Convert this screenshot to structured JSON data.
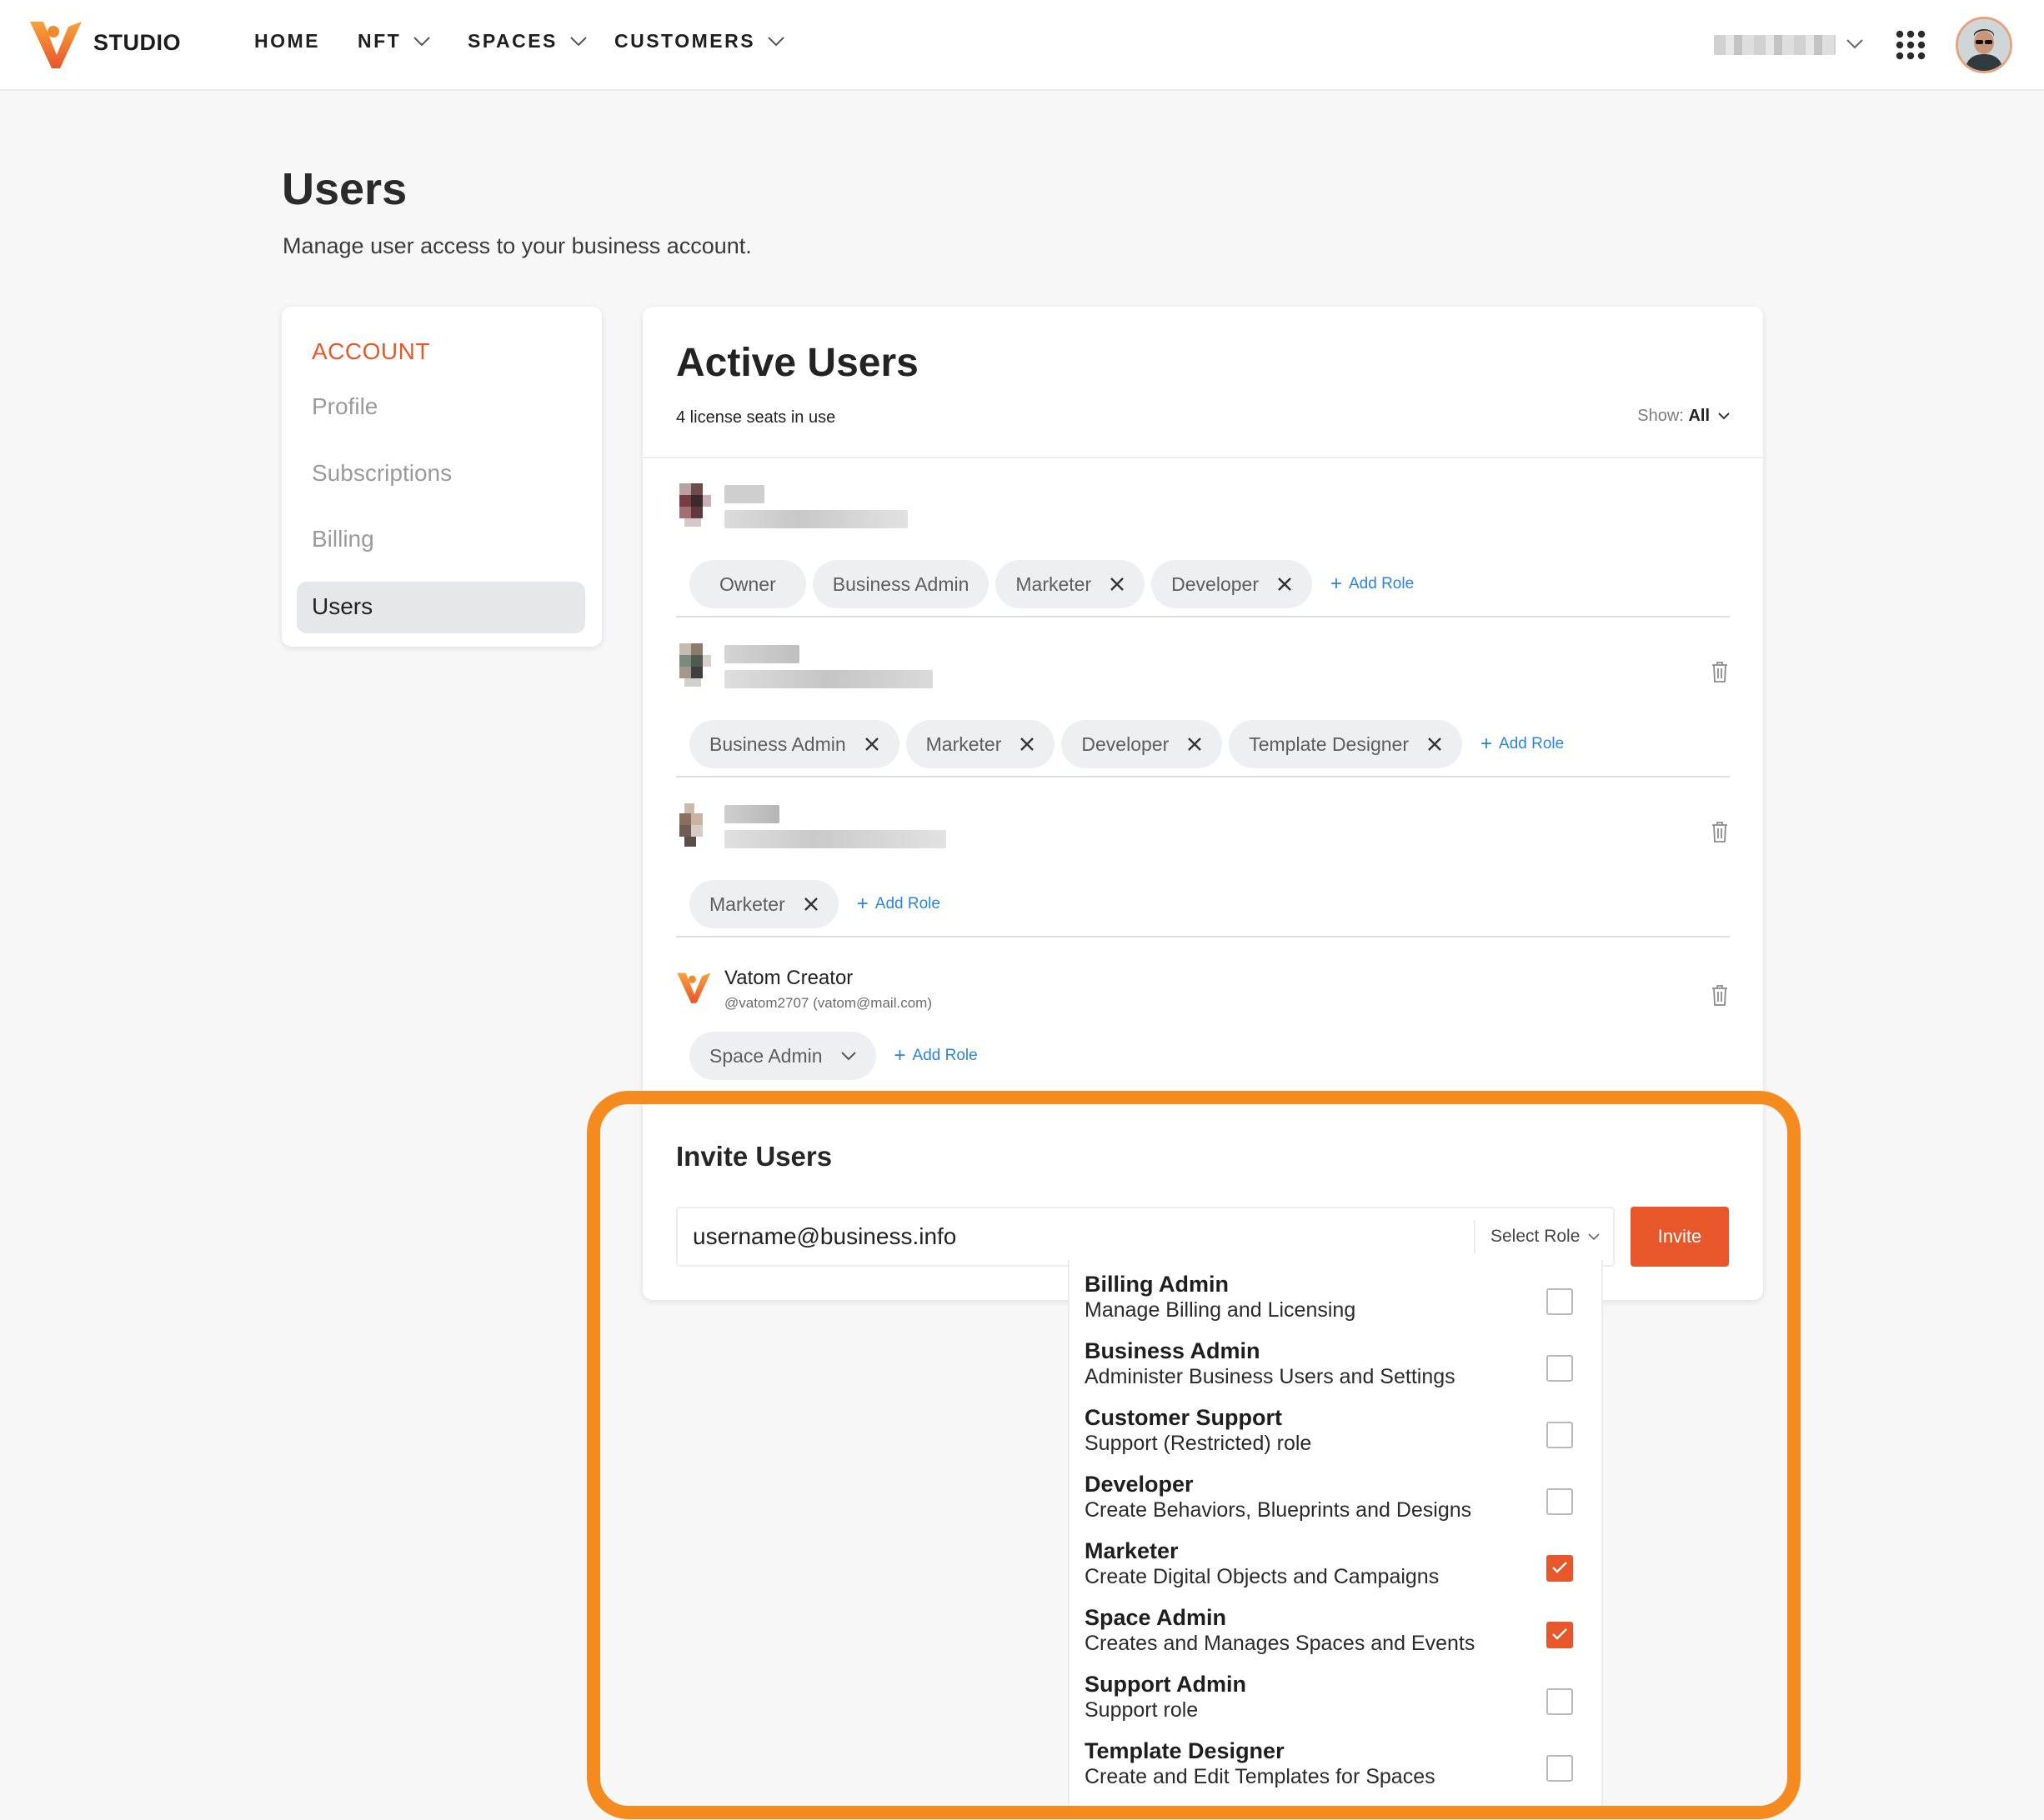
{
  "brand": {
    "logo_text": "STUDIO",
    "accent": "#e8572a",
    "highlight": "#f58a1f"
  },
  "nav": {
    "items": [
      {
        "label": "HOME",
        "has_menu": false
      },
      {
        "label": "NFT",
        "has_menu": true
      },
      {
        "label": "SPACES",
        "has_menu": true
      },
      {
        "label": "CUSTOMERS",
        "has_menu": true
      }
    ],
    "icons": [
      "chevron-down-icon",
      "apps-grid-icon",
      "user-avatar"
    ]
  },
  "page": {
    "title": "Users",
    "subtitle": "Manage user access to your business account."
  },
  "sidebar": {
    "heading": "ACCOUNT",
    "items": [
      {
        "label": "Profile",
        "active": false
      },
      {
        "label": "Subscriptions",
        "active": false
      },
      {
        "label": "Billing",
        "active": false
      },
      {
        "label": "Users",
        "active": true
      }
    ]
  },
  "active_users": {
    "title": "Active Users",
    "seats": "4 license seats in use",
    "show_label": "Show:",
    "show_value": "All",
    "add_role_label": "Add Role",
    "users": [
      {
        "name": "",
        "handle": "",
        "roles": [
          {
            "label": "Owner",
            "removable": false
          },
          {
            "label": "Business Admin",
            "removable": false
          },
          {
            "label": "Marketer",
            "removable": true
          },
          {
            "label": "Developer",
            "removable": true
          }
        ]
      },
      {
        "name": "",
        "handle": "",
        "roles": [
          {
            "label": "Business Admin",
            "removable": true
          },
          {
            "label": "Marketer",
            "removable": true
          },
          {
            "label": "Developer",
            "removable": true
          },
          {
            "label": "Template Designer",
            "removable": true
          }
        ]
      },
      {
        "name": "",
        "handle": "",
        "roles": [
          {
            "label": "Marketer",
            "removable": true
          }
        ]
      },
      {
        "name": "Vatom Creator",
        "handle": "@vatom2707 (vatom@mail.com)",
        "roles": [
          {
            "label": "Space Admin",
            "dropdown": true
          }
        ]
      }
    ]
  },
  "invite": {
    "title": "Invite Users",
    "email_value": "username@business.info",
    "select_role_label": "Select Role",
    "button_label": "Invite",
    "role_options": [
      {
        "name": "Billing Admin",
        "description": "Manage Billing and Licensing",
        "checked": false
      },
      {
        "name": "Business Admin",
        "description": "Administer Business Users and Settings",
        "checked": false
      },
      {
        "name": "Customer Support",
        "description": "Support (Restricted) role",
        "checked": false
      },
      {
        "name": "Developer",
        "description": "Create Behaviors, Blueprints and Designs",
        "checked": false
      },
      {
        "name": "Marketer",
        "description": "Create Digital Objects and Campaigns",
        "checked": true
      },
      {
        "name": "Space Admin",
        "description": "Creates and Manages Spaces and Events",
        "checked": true
      },
      {
        "name": "Support Admin",
        "description": "Support role",
        "checked": false
      },
      {
        "name": "Template Designer",
        "description": "Create and Edit Templates for Spaces",
        "checked": false
      }
    ]
  }
}
